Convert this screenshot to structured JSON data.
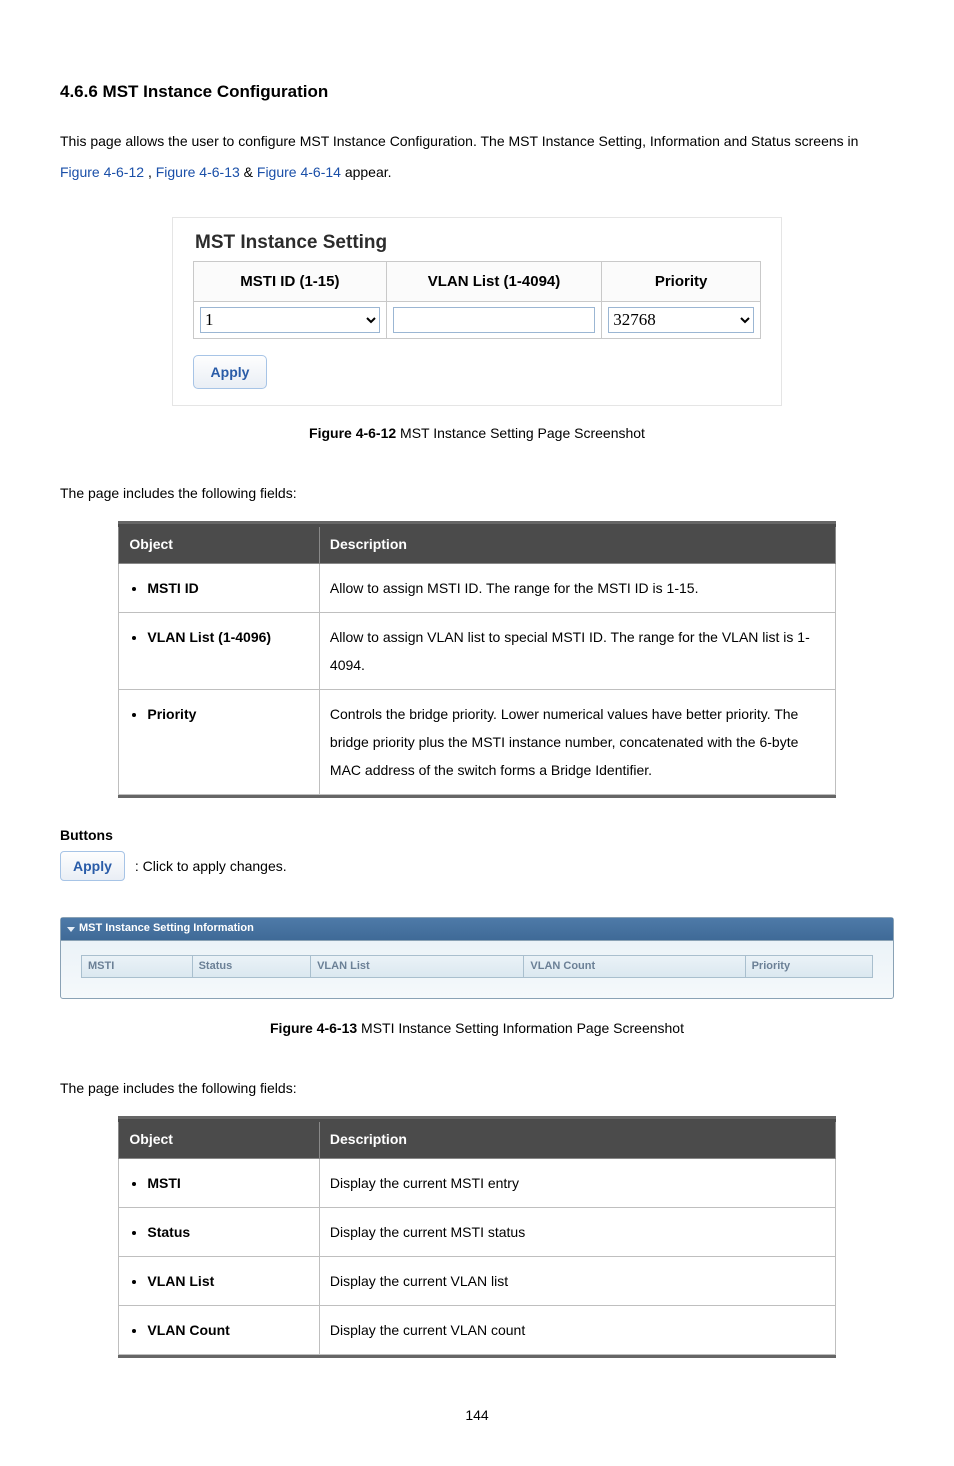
{
  "page_number": "144",
  "section_heading": "4.6.6 MST Instance Configuration",
  "intro": {
    "before_links": "This page allows the user to configure MST Instance Configuration. The MST Instance Setting, Information and Status screens in ",
    "link1": "Figure 4-6-12",
    "sep1": ", ",
    "link2": "Figure 4-6-13",
    "sep2": " & ",
    "link3": "Figure 4-6-14",
    "after_links": " appear."
  },
  "shot1": {
    "title": "MST Instance Setting",
    "headers": {
      "col1": "MSTI ID (1-15)",
      "col2": "VLAN List (1-4094)",
      "col3": "Priority"
    },
    "values": {
      "msti_id": "1",
      "vlan_list": "",
      "priority": "32768"
    },
    "apply_label": "Apply"
  },
  "caption1": {
    "bold": "Figure 4-6-12",
    "rest": " MST Instance Setting Page Screenshot"
  },
  "lead1": "The page includes the following fields:",
  "table1": {
    "headers": {
      "object": "Object",
      "description": "Description"
    },
    "rows": [
      {
        "object": "MSTI ID",
        "description": "Allow to assign MSTI ID. The range for the MSTI ID is 1-15."
      },
      {
        "object": "VLAN List (1-4096)",
        "description": "Allow to assign VLAN list to special MSTI ID. The range for the VLAN list is 1-4094."
      },
      {
        "object": "Priority",
        "description": "Controls the bridge priority. Lower numerical values have better priority. The bridge priority plus the MSTI instance number, concatenated with the 6-byte MAC address of the switch forms a Bridge Identifier."
      }
    ]
  },
  "buttons_heading": "Buttons",
  "apply_inline_label": "Apply",
  "apply_inline_desc": ": Click to apply changes.",
  "shot2": {
    "header_title": "MST Instance Setting Information",
    "cols": {
      "c1": "MSTI",
      "c2": "Status",
      "c3": "VLAN List",
      "c4": "VLAN Count",
      "c5": "Priority"
    }
  },
  "caption2": {
    "bold": "Figure 4-6-13",
    "rest": " MSTI Instance Setting Information Page Screenshot"
  },
  "lead2": "The page includes the following fields:",
  "table2": {
    "headers": {
      "object": "Object",
      "description": "Description"
    },
    "rows": [
      {
        "object": "MSTI",
        "description": "Display the current MSTI entry"
      },
      {
        "object": "Status",
        "description": "Display the current MSTI status"
      },
      {
        "object": "VLAN List",
        "description": "Display the current VLAN list"
      },
      {
        "object": "VLAN Count",
        "description": "Display the current VLAN count"
      }
    ]
  }
}
